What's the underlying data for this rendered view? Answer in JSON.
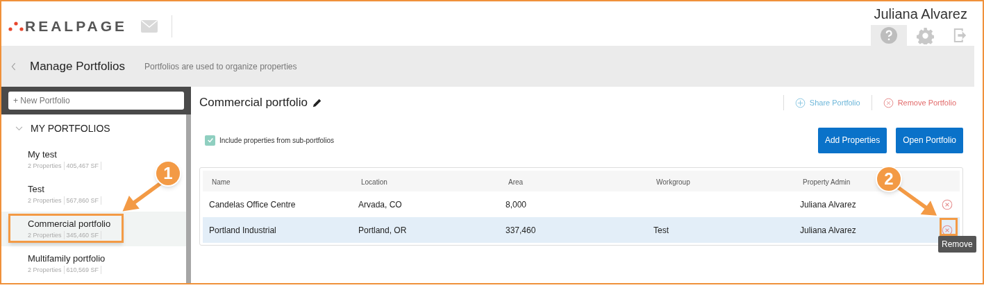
{
  "header": {
    "logo_text": "REALPAGE",
    "user_name": "Juliana Alvarez"
  },
  "page_bar": {
    "title": "Manage Portfolios",
    "subtitle": "Portfolios are used to organize properties"
  },
  "sidebar": {
    "new_portfolio": {
      "placeholder": "+ New Portfolio"
    },
    "section": {
      "label": "MY PORTFOLIOS",
      "expanded": true
    },
    "portfolios": [
      {
        "name": "My test",
        "properties": "2 Properties",
        "area": "405,467 SF",
        "selected": false
      },
      {
        "name": "Test",
        "properties": "2 Properties",
        "area": "567,860 SF",
        "selected": false
      },
      {
        "name": "Commercial portfolio",
        "properties": "2 Properties",
        "area": "345,460 SF",
        "selected": true
      },
      {
        "name": "Multifamily portfolio",
        "properties": "2 Properties",
        "area": "610,569 SF",
        "selected": false
      }
    ]
  },
  "content": {
    "title": "Commercial portfolio",
    "actions": [
      {
        "label": "Share Portfolio",
        "kind": "share"
      },
      {
        "label": "Remove Portfolio",
        "kind": "remove"
      }
    ],
    "include_checkbox": {
      "label": "Include properties from sub-portfolios",
      "checked": true
    },
    "buttons": [
      "Add Properties",
      "Open Portfolio"
    ],
    "table": {
      "columns": [
        "Name",
        "Location",
        "Area",
        "Workgroup",
        "Property Admin"
      ],
      "rows": [
        {
          "cells": [
            "Candelas Office Centre",
            "Arvada, CO",
            "8,000",
            "",
            "Juliana Alvarez"
          ],
          "selected": false
        },
        {
          "cells": [
            "Portland Industrial",
            "Portland, OR",
            "337,460",
            "Test",
            "Juliana Alvarez"
          ],
          "selected": true
        }
      ]
    },
    "tooltip": "Remove"
  },
  "annotations": [
    {
      "label": "1"
    },
    {
      "label": "2"
    }
  ]
}
